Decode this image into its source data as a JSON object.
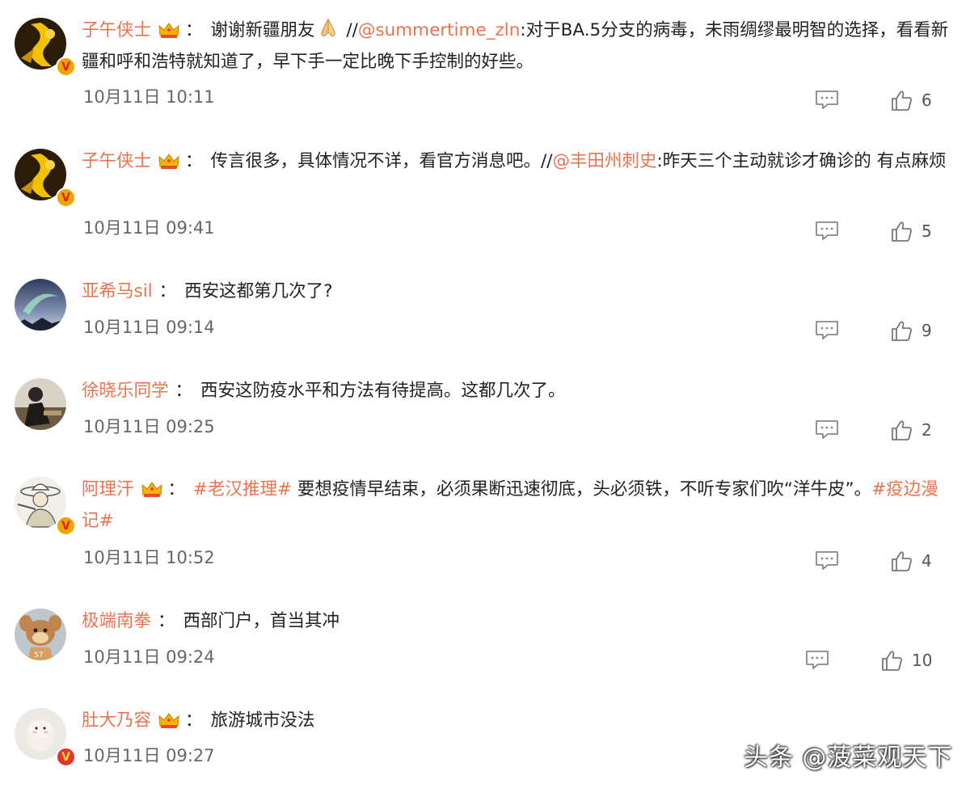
{
  "comments": [
    {
      "username": "子午侠士",
      "has_crown": true,
      "badge": "V",
      "segments": [
        {
          "t": "text",
          "v": "谢谢新疆朋友"
        },
        {
          "t": "emoji",
          "v": "pray-hands"
        },
        {
          "t": "text",
          "v": " //"
        },
        {
          "t": "mention",
          "v": "@summertime_zln"
        },
        {
          "t": "text",
          "v": ":对于BA.5分支的病毒，未雨绸缪最明智的选择，看看新疆和呼和浩特就知道了，早下手一定比晚下手控制的好些。"
        }
      ],
      "time": "10月11日 10:11",
      "likes": "6"
    },
    {
      "username": "子午侠士",
      "has_crown": true,
      "badge": "V",
      "segments": [
        {
          "t": "text",
          "v": "传言很多，具体情况不详，看官方消息吧。//"
        },
        {
          "t": "mention",
          "v": "@丰田州刺史"
        },
        {
          "t": "text",
          "v": ":昨天三个主动就诊才确诊的 有点麻烦"
        }
      ],
      "time": "10月11日 09:41",
      "likes": "5"
    },
    {
      "username": "亚希马sil",
      "has_crown": false,
      "badge": "",
      "segments": [
        {
          "t": "text",
          "v": "西安这都第几次了?"
        }
      ],
      "time": "10月11日 09:14",
      "likes": "9"
    },
    {
      "username": "徐晓乐同学",
      "has_crown": false,
      "badge": "",
      "segments": [
        {
          "t": "text",
          "v": "西安这防疫水平和方法有待提高。这都几次了。"
        }
      ],
      "time": "10月11日 09:25",
      "likes": "2"
    },
    {
      "username": "阿理汗",
      "has_crown": true,
      "badge": "V",
      "segments": [
        {
          "t": "topic",
          "v": "#老汉推理#"
        },
        {
          "t": "text",
          "v": " 要想疫情早结束，必须果断迅速彻底，头必须铁，不听专家们吹“洋牛皮”。"
        },
        {
          "t": "topic",
          "v": "#疫边漫记#"
        }
      ],
      "time": "10月11日 10:52",
      "likes": "4"
    },
    {
      "username": "极端南拳",
      "has_crown": false,
      "badge": "",
      "segments": [
        {
          "t": "text",
          "v": "西部门户，首当其冲"
        }
      ],
      "time": "10月11日 09:24",
      "likes": "10"
    },
    {
      "username": "肚大乃容",
      "has_crown": true,
      "badge": "V",
      "segments": [
        {
          "t": "text",
          "v": "旅游城市没法"
        }
      ],
      "time": "10月11日 09:27",
      "likes": ""
    }
  ],
  "watermark": "头条 @菠菜观天下",
  "colors": {
    "username": "#eb7350",
    "text": "#222222",
    "time": "#666666",
    "icon": "#888888"
  }
}
